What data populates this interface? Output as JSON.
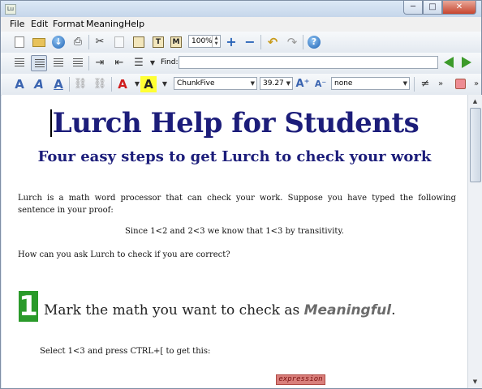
{
  "window": {
    "app_icon_glyph": "Lu",
    "minimize": "─",
    "maximize": "□",
    "close": "✕"
  },
  "menubar": [
    "File",
    "Edit",
    "Format",
    "Meaning",
    "Help"
  ],
  "toolbar1": {
    "zoom": "100%"
  },
  "toolbar2": {
    "find_label": "Find:",
    "find_value": ""
  },
  "toolbar3": {
    "font_name": "ChunkFive",
    "font_size": "39.27",
    "style_value": "none",
    "neq_symbol": "≠"
  },
  "document": {
    "title": "Lurch Help for Students",
    "subtitle": "Four easy steps to get Lurch to check your work",
    "para1": "Lurch is a math word processor that can check your work.  Suppose you have typed the following sentence in your proof:",
    "example": "Since 1<2 and 2<3 we know that 1<3 by transitivity.",
    "para2": "How can you ask Lurch to check if you are correct?",
    "step_number": "1",
    "step_text_before": "Mark the math you want to check as ",
    "step_text_em": "Meaningful",
    "step_text_after": ".",
    "instruction": "Select 1<3 and press CTRL+[ to get this:",
    "bubble_label": "expression"
  },
  "colors": {
    "heading": "#1c1d7a",
    "step_badge": "#2a9a2a",
    "bubble": "#d97f7b"
  }
}
